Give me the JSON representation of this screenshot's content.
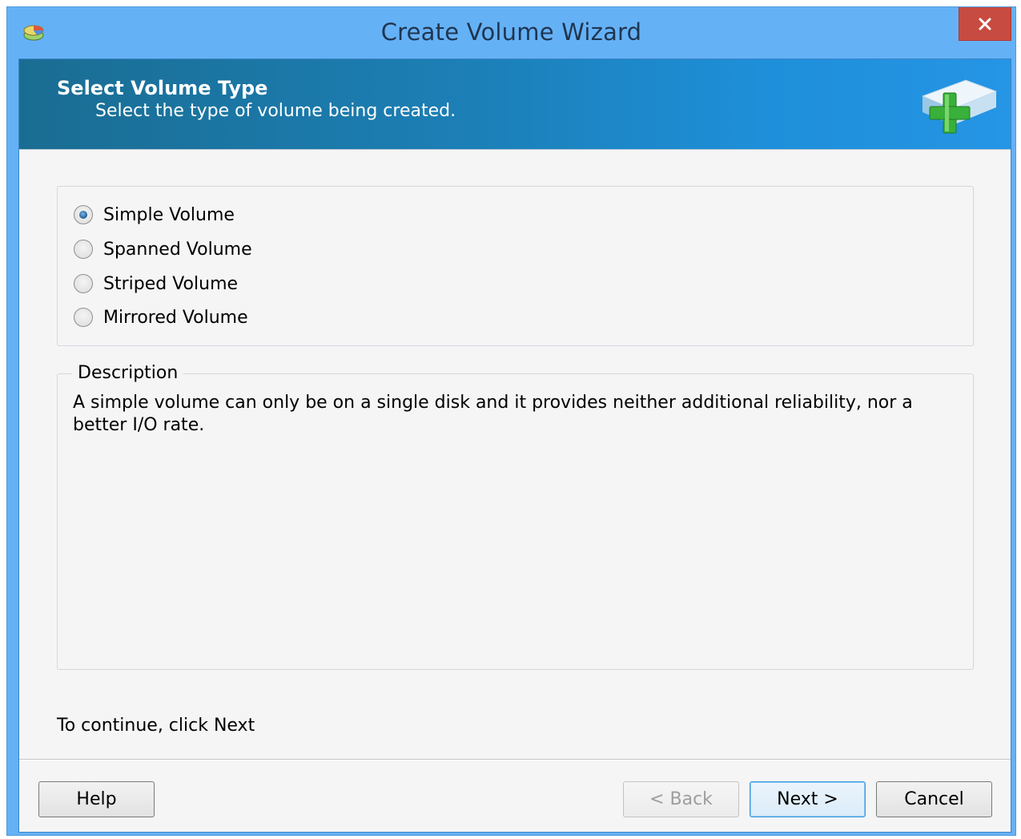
{
  "window": {
    "title": "Create Volume Wizard",
    "app_icon": "disk-management-icon",
    "close_icon": "close-icon"
  },
  "banner": {
    "title": "Select Volume Type",
    "subtitle": "Select the type of volume being created.",
    "icon": "add-volume-icon"
  },
  "volume_types": {
    "selected": "Simple Volume",
    "options": [
      {
        "label": "Simple Volume",
        "checked": true
      },
      {
        "label": "Spanned Volume",
        "checked": false
      },
      {
        "label": "Striped Volume",
        "checked": false
      },
      {
        "label": "Mirrored Volume",
        "checked": false
      }
    ]
  },
  "description": {
    "legend": "Description",
    "text": "A simple volume can only be on a single disk and it provides neither additional reliability, nor a better I/O rate."
  },
  "hint": "To continue, click Next",
  "buttons": {
    "help": "Help",
    "back": "< Back",
    "next": "Next >",
    "cancel": "Cancel"
  },
  "colors": {
    "titlebar": "#65b1f6",
    "close_button": "#c74b40",
    "banner_start": "#1a6d92",
    "banner_end": "#2595e5",
    "client_bg": "#f5f5f5"
  }
}
